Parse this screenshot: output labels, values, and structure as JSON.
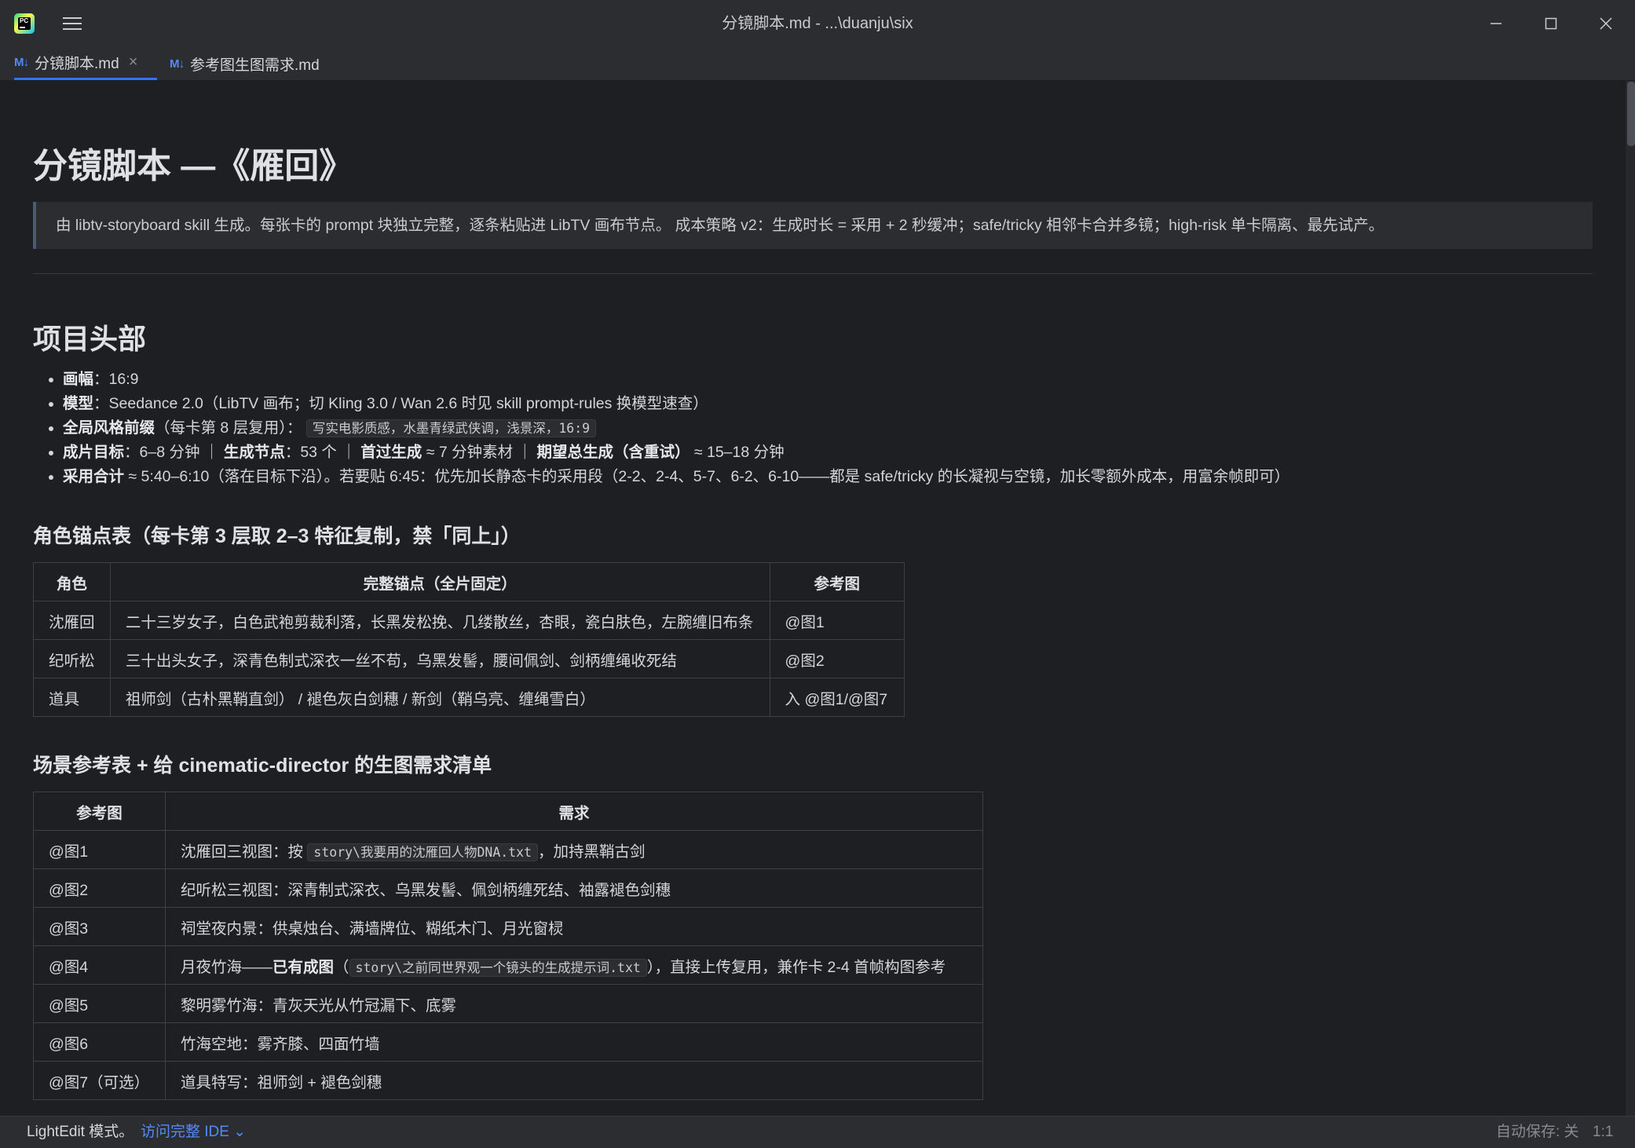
{
  "window": {
    "title": "分镜脚本.md - ...\\duanju\\six",
    "minimize_icon": "minimize-icon",
    "maximize_icon": "maximize-icon",
    "close_icon": "close-icon"
  },
  "tabs": [
    {
      "icon": "M↓",
      "label": "分镜脚本.md",
      "active": true,
      "close": "×"
    },
    {
      "icon": "M↓",
      "label": "参考图生图需求.md",
      "active": false
    }
  ],
  "doc": {
    "h1": "分镜脚本 —《雁回》",
    "blockquote": "由 libtv-storyboard skill 生成。每张卡的 prompt 块独立完整，逐条粘贴进 LibTV 画布节点。 成本策略 v2：生成时长 = 采用 + 2 秒缓冲；safe/tricky 相邻卡合并多镜；high-risk 单卡隔离、最先试产。",
    "section1_title": "项目头部",
    "bullets": {
      "b1_label": "画幅",
      "b1_text": "：16:9",
      "b2_label": "模型",
      "b2_text": "：Seedance 2.0（LibTV 画布；切 Kling 3.0 / Wan 2.6 时见 skill prompt-rules 换模型速查）",
      "b3_label": "全局风格前缀",
      "b3_text": "（每卡第 8 层复用）：",
      "b3_code": "写实电影质感，水墨青绿武侠调，浅景深，16:9",
      "b4_l1": "成片目标",
      "b4_t1": "：6–8 分钟 ｜ ",
      "b4_l2": "生成节点",
      "b4_t2": "：53 个 ｜ ",
      "b4_l3": "首过生成",
      "b4_t3": " ≈ 7 分钟素材 ｜ ",
      "b4_l4": "期望总生成（含重试）",
      "b4_t4": " ≈ 15–18 分钟",
      "b5_label": "采用合计",
      "b5_text": " ≈ 5:40–6:10（落在目标下沿）。若要贴 6:45：优先加长静态卡的采用段（2-2、2-4、5-7、6-2、6-10——都是 safe/tricky 的长凝视与空镜，加长零额外成本，用富余帧即可）"
    },
    "section2_title": "角色锚点表（每卡第 3 层取 2–3 特征复制，禁「同上」）",
    "table1": {
      "headers": [
        "角色",
        "完整锚点（全片固定）",
        "参考图"
      ],
      "rows": [
        [
          "沈雁回",
          "二十三岁女子，白色武袍剪裁利落，长黑发松挽、几缕散丝，杏眼，瓷白肤色，左腕缠旧布条",
          "@图1"
        ],
        [
          "纪听松",
          "三十出头女子，深青色制式深衣一丝不苟，乌黑发髻，腰间佩剑、剑柄缠绳收死结",
          "@图2"
        ],
        [
          "道具",
          "祖师剑（古朴黑鞘直剑） / 褪色灰白剑穗 / 新剑（鞘乌亮、缠绳雪白）",
          "入 @图1/@图7"
        ]
      ]
    },
    "section3_title": "场景参考表 + 给 cinematic-director 的生图需求清单",
    "table2": {
      "headers": [
        "参考图",
        "需求"
      ],
      "r1_c1": "@图1",
      "r1_pre": "沈雁回三视图：按 ",
      "r1_code": "story\\我要用的沈雁回人物DNA.txt",
      "r1_post": "，加持黑鞘古剑",
      "r2_c1": "@图2",
      "r2_c2": "纪听松三视图：深青制式深衣、乌黑发髻、佩剑柄缠死结、袖露褪色剑穗",
      "r3_c1": "@图3",
      "r3_c2": "祠堂夜内景：供桌烛台、满墙牌位、糊纸木门、月光窗棂",
      "r4_c1": "@图4",
      "r4_pre": "月夜竹海——",
      "r4_bold": "已有成图",
      "r4_mid": "（",
      "r4_code": "story\\之前同世界观一个镜头的生成提示词.txt",
      "r4_post": "），直接上传复用，兼作卡 2-4 首帧构图参考",
      "r5_c1": "@图5",
      "r5_c2": "黎明雾竹海：青灰天光从竹冠漏下、底雾",
      "r6_c1": "@图6",
      "r6_c2": "竹海空地：雾齐膝、四面竹墙",
      "r7_c1": "@图7（可选）",
      "r7_c2": "道具特写：祖师剑 + 褪色剑穗"
    }
  },
  "statusbar": {
    "mode": "LightEdit 模式。",
    "link": "访问完整 IDE",
    "autosave": "自动保存: 关",
    "position": "1:1"
  },
  "colors": {
    "background": "#1e1f22",
    "chrome": "#2b2d30",
    "accent": "#3574f0",
    "link": "#548af7"
  }
}
